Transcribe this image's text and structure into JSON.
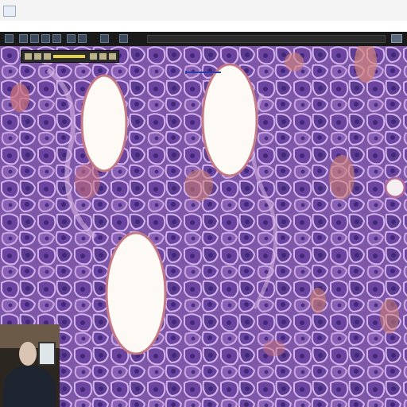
{
  "window": {
    "title": "",
    "app_icon": "slide-viewer-app-icon"
  },
  "menubar": {
    "items": []
  },
  "toolbar": {
    "tool_icons": [
      "open-icon",
      "zoom-in-icon",
      "zoom-out-icon",
      "pan-icon",
      "annotate-icon",
      "measure-icon",
      "layers-icon",
      "settings-icon",
      "fullscreen-icon"
    ]
  },
  "viewer": {
    "content": "histology-slide",
    "stain_colors": {
      "background": "#8a62b0",
      "cell": "#6f4aa0",
      "membrane": "#c9a6e0",
      "nucleus": "#4b2f86",
      "eosin": "#c8707a",
      "lumen": "#fdfaf6"
    }
  },
  "annotation": {
    "color": "#2a3fa8"
  },
  "webcam": {
    "present": true
  }
}
